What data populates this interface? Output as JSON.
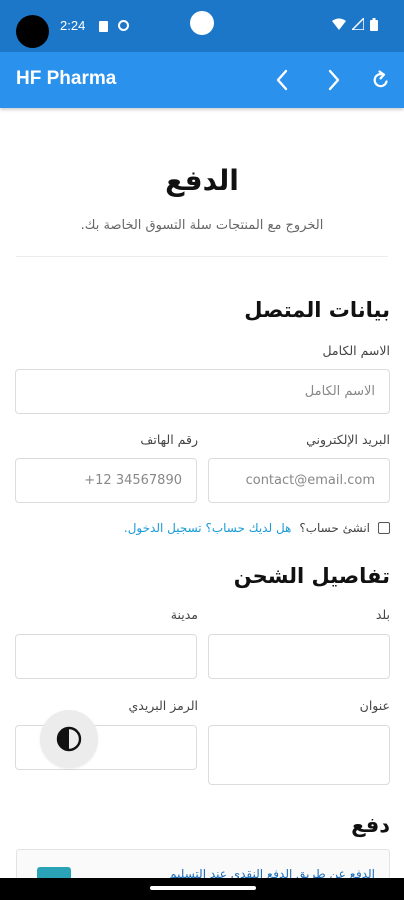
{
  "status_bar": {
    "time": "2:24"
  },
  "app_bar": {
    "title": "HF Pharma"
  },
  "page": {
    "title": "الدفع",
    "subtitle": "الخروج مع المنتجات سلة التسوق الخاصة بك."
  },
  "contact": {
    "section_title": "بيانات المتصل",
    "full_name_label": "الاسم الكامل",
    "full_name_placeholder": "الاسم الكامل",
    "email_label": "البريد الإلكتروني",
    "email_placeholder": "contact@email.com",
    "phone_label": "رقم الهاتف",
    "phone_placeholder": "+12 34567890",
    "create_account_text": "انشئ حساب؟",
    "login_link": "هل لديك حساب؟ تسجيل الدخول."
  },
  "shipping": {
    "section_title": "تفاصيل الشحن",
    "country_label": "بلد",
    "city_label": "مدينة",
    "address_label": "عنوان",
    "postal_label": "الرمز البريدي"
  },
  "payment": {
    "section_title": "دفع",
    "method_text": "الدفع عن طريق الدفع النقدي عند التسليم"
  },
  "colors": {
    "status_bar": "#1d77c8",
    "app_bar": "#2a91ec",
    "link": "#1a9bd7"
  }
}
